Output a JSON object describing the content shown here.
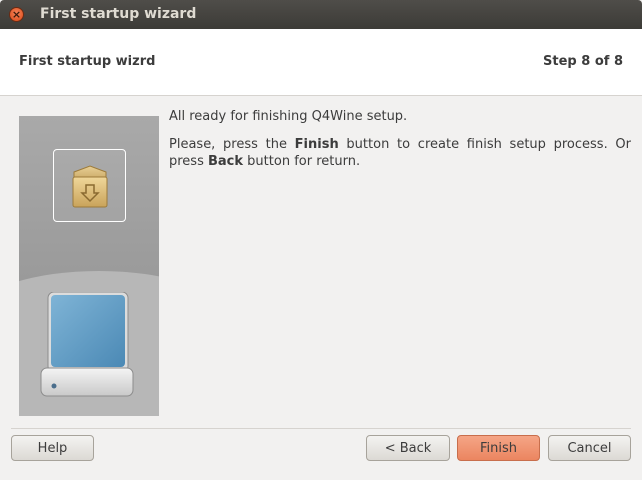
{
  "window": {
    "title": "First startup wizard",
    "close_icon": "close-icon"
  },
  "header": {
    "title": "First startup wizrd",
    "step": "Step 8 of 8"
  },
  "side_image": {
    "icons": [
      "package-download-icon",
      "hard-drive-icon"
    ]
  },
  "content": {
    "line1": "All ready for finishing Q4Wine setup.",
    "line2_part1": "Please, press the ",
    "line2_bold1": "Finish",
    "line2_part2": " button to create finish setup process. Or press ",
    "line2_bold2": "Back",
    "line2_part3": " button for return."
  },
  "buttons": {
    "help": "Help",
    "back": "< Back",
    "finish": "Finish",
    "cancel": "Cancel"
  },
  "colors": {
    "titlebar": "#3c3b37",
    "finish_accent": "#eb8560",
    "close_accent": "#e25a2a"
  }
}
